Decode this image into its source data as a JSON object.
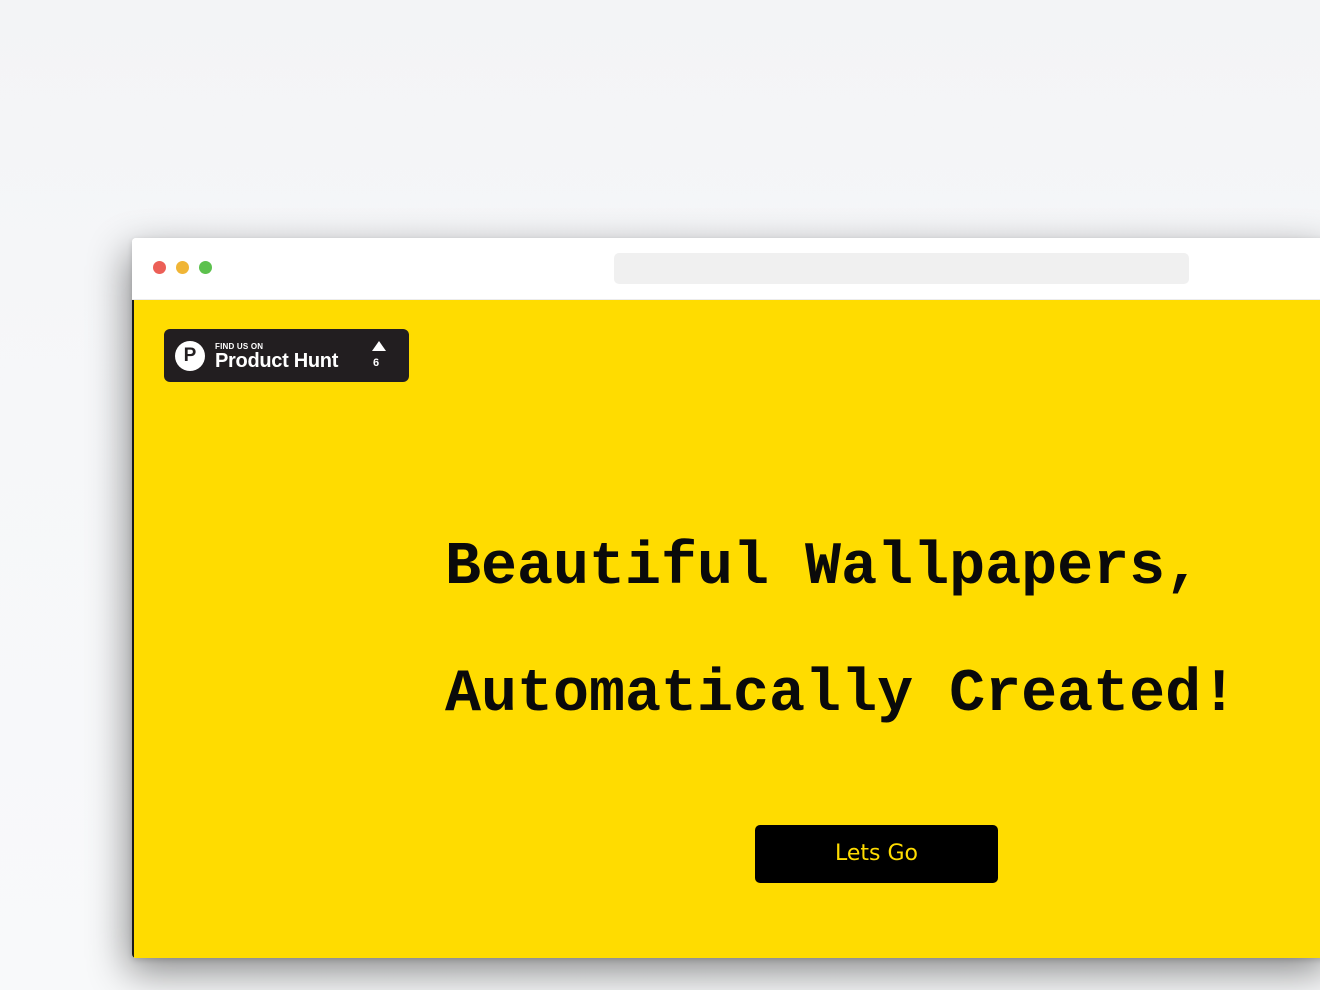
{
  "colors": {
    "page_background": "#f5f6f8",
    "hero_background": "#ffdc00",
    "headline_text": "#0a0a0a",
    "cta_background": "#000000",
    "cta_text": "#ffdc00",
    "badge_background": "#221e20",
    "traffic_close": "#ec5f57",
    "traffic_minimize": "#f0b536",
    "traffic_maximize": "#5cc14d"
  },
  "browser": {
    "traffic_lights": [
      "close",
      "minimize",
      "maximize"
    ],
    "address_bar": ""
  },
  "product_hunt_badge": {
    "logo_letter": "P",
    "small_label": "FIND US ON",
    "name": "Product Hunt",
    "upvote_icon": "triangle-up-icon",
    "upvote_count": "6"
  },
  "hero": {
    "headline_line1": "Beautiful Wallpapers,",
    "headline_line2": "Automatically Created!",
    "cta_label": "Lets Go"
  }
}
